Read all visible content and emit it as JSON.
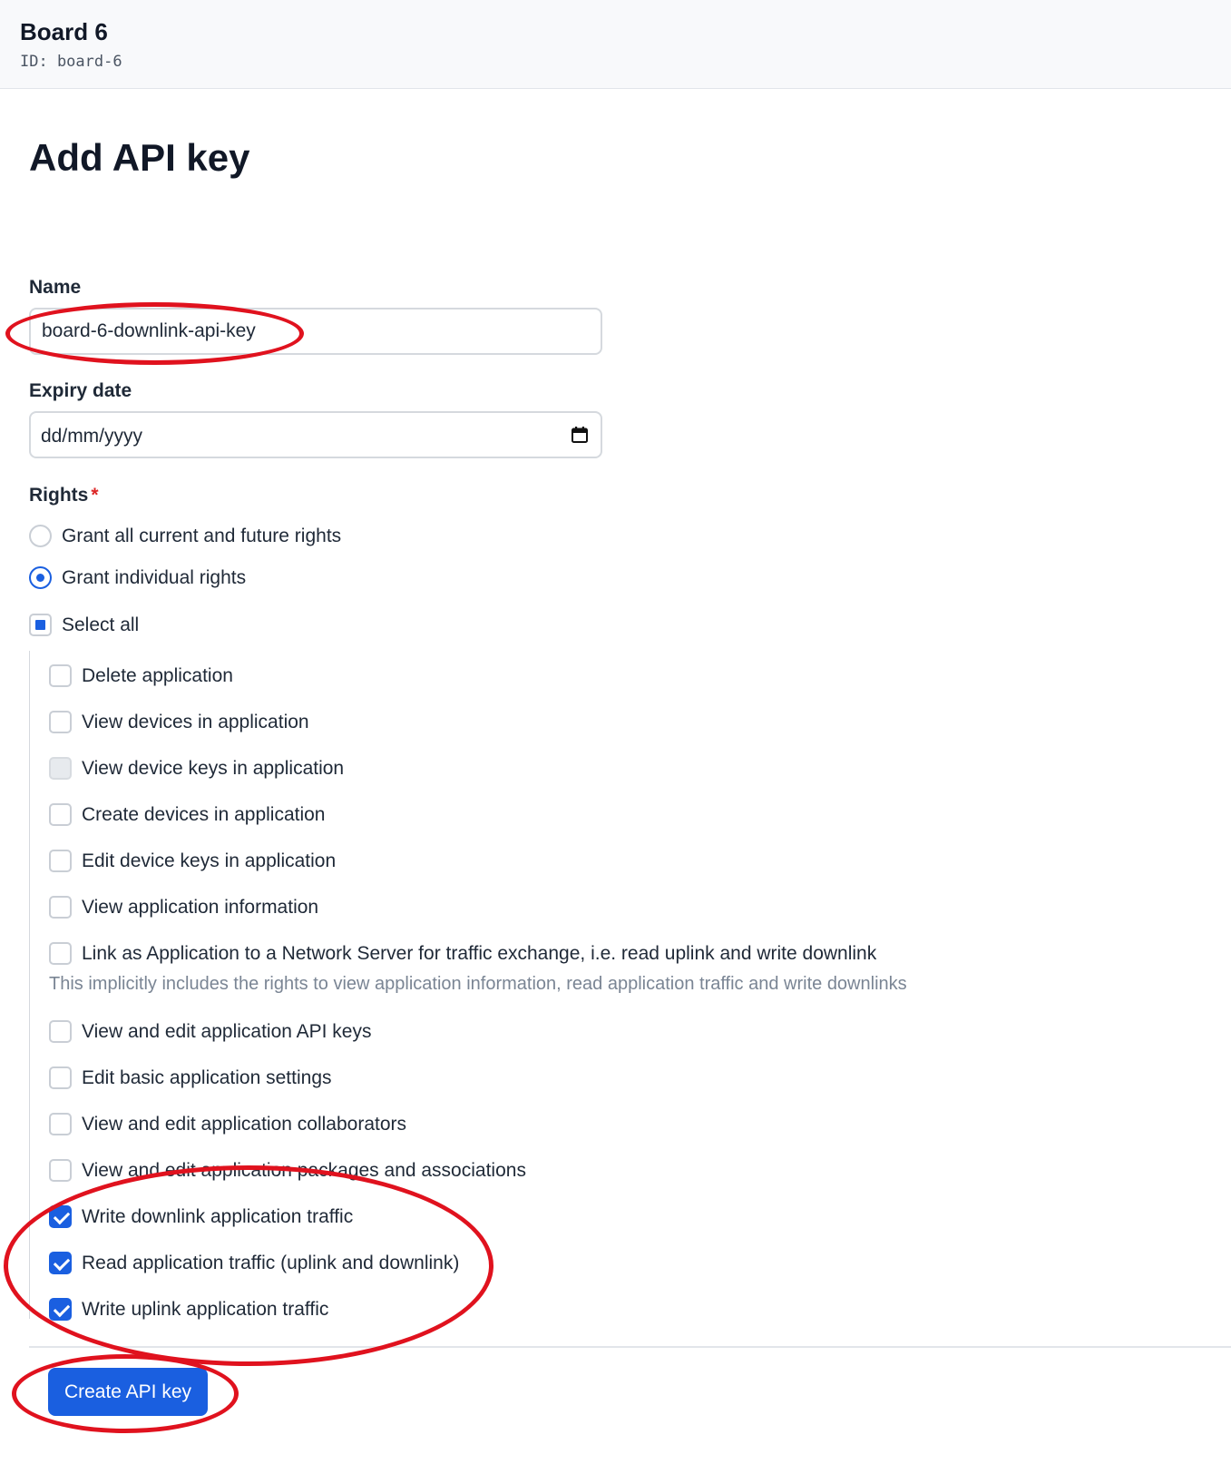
{
  "header": {
    "title": "Board 6",
    "id_label": "ID: board-6"
  },
  "page_title": "Add API key",
  "form": {
    "name_label": "Name",
    "name_value": "board-6-downlink-api-key",
    "expiry_label": "Expiry date",
    "expiry_placeholder": "dd/mm/yyyy",
    "rights_label": "Rights",
    "required_mark": "*",
    "grant_all_label": "Grant all current and future rights",
    "grant_individual_label": "Grant individual rights",
    "select_all_label": "Select all",
    "rights": [
      {
        "label": "Delete application",
        "checked": false,
        "disabled": false
      },
      {
        "label": "View devices in application",
        "checked": false,
        "disabled": false
      },
      {
        "label": "View device keys in application",
        "checked": false,
        "disabled": true
      },
      {
        "label": "Create devices in application",
        "checked": false,
        "disabled": false
      },
      {
        "label": "Edit device keys in application",
        "checked": false,
        "disabled": false
      },
      {
        "label": "View application information",
        "checked": false,
        "disabled": false
      },
      {
        "label": "Link as Application to a Network Server for traffic exchange, i.e. read uplink and write downlink",
        "checked": false,
        "disabled": false
      },
      {
        "label": "View and edit application API keys",
        "checked": false,
        "disabled": false
      },
      {
        "label": "Edit basic application settings",
        "checked": false,
        "disabled": false
      },
      {
        "label": "View and edit application collaborators",
        "checked": false,
        "disabled": false
      },
      {
        "label": "View and edit application packages and associations",
        "checked": false,
        "disabled": false
      },
      {
        "label": "Write downlink application traffic",
        "checked": true,
        "disabled": false
      },
      {
        "label": "Read application traffic (uplink and downlink)",
        "checked": true,
        "disabled": false
      },
      {
        "label": "Write uplink application traffic",
        "checked": true,
        "disabled": false
      }
    ],
    "link_hint": "This implicitly includes the rights to view application information, read application traffic and write downlinks",
    "submit_label": "Create API key"
  },
  "colors": {
    "primary": "#1a5fe0",
    "annotation": "#e0121e",
    "required": "#dc2626"
  }
}
